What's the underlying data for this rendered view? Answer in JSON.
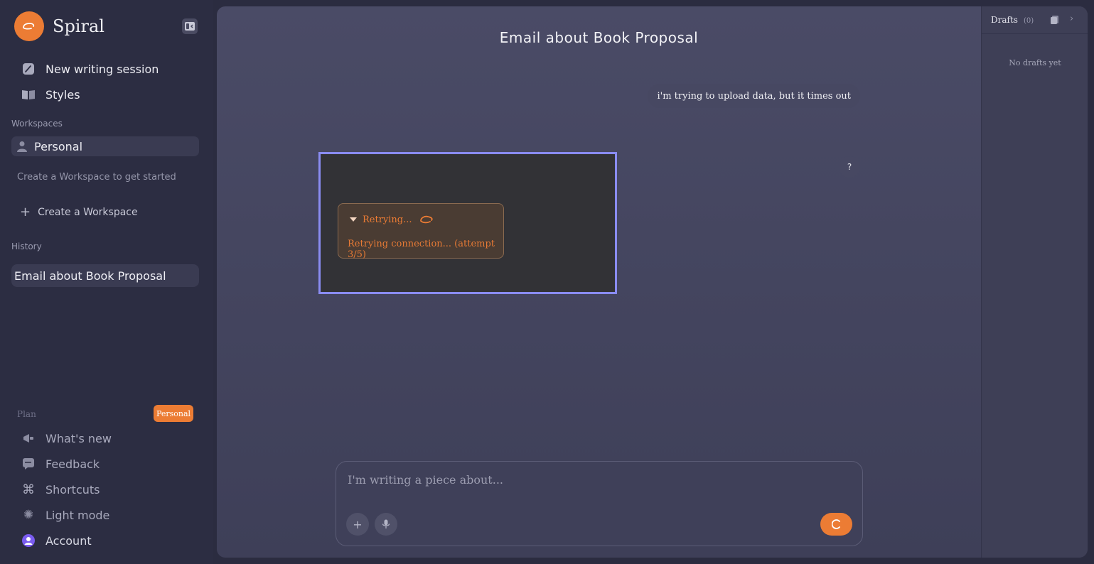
{
  "brand": {
    "name": "Spiral"
  },
  "sidebar": {
    "primary": [
      {
        "label": "New writing session",
        "icon": "pen-compose-icon"
      },
      {
        "label": "Styles",
        "icon": "book-open-icon"
      }
    ],
    "workspaces_label": "Workspaces",
    "workspace_personal": "Personal",
    "workspace_hint": "Create a Workspace to get started",
    "create_workspace": "Create a Workspace",
    "history_label": "History",
    "history_items": [
      "Email about Book Proposal"
    ],
    "plan_label": "Plan",
    "plan_badge": "Personal",
    "footer": [
      {
        "label": "What's new",
        "icon": "megaphone-icon"
      },
      {
        "label": "Feedback",
        "icon": "chat-bubble-icon"
      },
      {
        "label": "Shortcuts",
        "icon": "command-icon"
      },
      {
        "label": "Light mode",
        "icon": "sun-icon"
      },
      {
        "label": "Account",
        "icon": "user-avatar-icon"
      }
    ]
  },
  "main": {
    "title": "Email about Book Proposal",
    "user_message": "i'm trying to upload data, but it times out",
    "help_label": "?",
    "retry": {
      "header": "Retrying...",
      "status": "Retrying connection... (attempt 3/5)"
    },
    "composer": {
      "placeholder": "I'm writing a piece about..."
    }
  },
  "drafts": {
    "title": "Drafts",
    "count": "(0)",
    "empty": "No drafts yet"
  },
  "colors": {
    "accent": "#ec7c34",
    "focus_ring": "#8a8cf2",
    "sidebar_bg": "#2c2d42",
    "main_bg": "#45465f"
  }
}
